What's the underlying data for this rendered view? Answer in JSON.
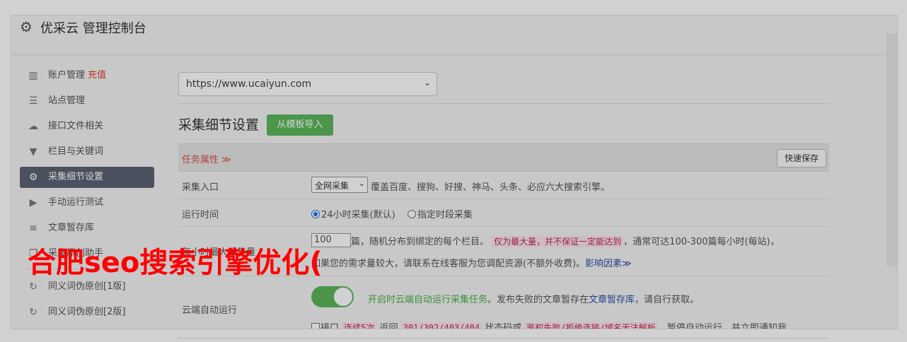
{
  "header": {
    "title": "优采云 管理控制台",
    "icon": "gear-icon"
  },
  "sidebar": {
    "items": [
      {
        "label": "账户管理",
        "extra": "充值",
        "icon": "bar-chart-icon"
      },
      {
        "label": "站点管理",
        "icon": "server-icon"
      },
      {
        "label": "接口文件相关",
        "icon": "cloud-upload-icon"
      },
      {
        "label": "栏目与关键词",
        "icon": "filter-icon"
      },
      {
        "label": "采集细节设置",
        "icon": "cogs-icon",
        "active": true
      },
      {
        "label": "手动运行测试",
        "icon": "play-circle-icon"
      },
      {
        "label": "文章暂存库",
        "icon": "database-icon"
      },
      {
        "label": "采集原创助手",
        "icon": "copy-icon"
      }
    ],
    "items2": [
      {
        "label": "同义词伪原创[1版]",
        "icon": "refresh-icon"
      },
      {
        "label": "同义词伪原创[2版]",
        "icon": "refresh-icon"
      }
    ]
  },
  "main": {
    "site_select": "https://www.ucaiyun.com",
    "section_title": "采集细节设置",
    "import_button": "从模板导入",
    "table": {
      "header_label": "任务属性 ≫",
      "save_button": "快速保存",
      "rows": {
        "entry": {
          "label": "采集入口",
          "select_value": "全网采集",
          "desc": "覆盖百度、搜狗、好搜、神马、头条、必应六大搜索引擎。"
        },
        "time": {
          "label": "运行时间",
          "option1": "24小时采集(默认)",
          "option2": "指定时段采集"
        },
        "max": {
          "label": "每小时最大采集量",
          "input_value": "100",
          "text1": "篇，随机分布到绑定的每个栏目。",
          "tag": "仅为最大量，并不保证一定能达到",
          "text2": "，通常可达100-300篇每小时(每站)，",
          "text3": "如果您的需求量较大，请联系在线客服为您调配资源(不额外收费)。",
          "link": "影响因素≫"
        },
        "cloud": {
          "label": "云端自动运行",
          "green_text": "开启时云端自动运行采集任务",
          "text1": "。发布失败的文章暂存在",
          "link": "文章暂存库",
          "text2": "，请自行获取。",
          "cb_label": "接口",
          "tag1": "连续5次",
          "text3": "返回",
          "tag2": "301/302/403/404",
          "text4": "状态码或",
          "tag3": "鉴权失败/拒绝连接/域名无法解析",
          "text5": "，暂停自动运行，并立即通知我。"
        }
      }
    }
  },
  "watermark": "合肥seo搜索引擎优化("
}
